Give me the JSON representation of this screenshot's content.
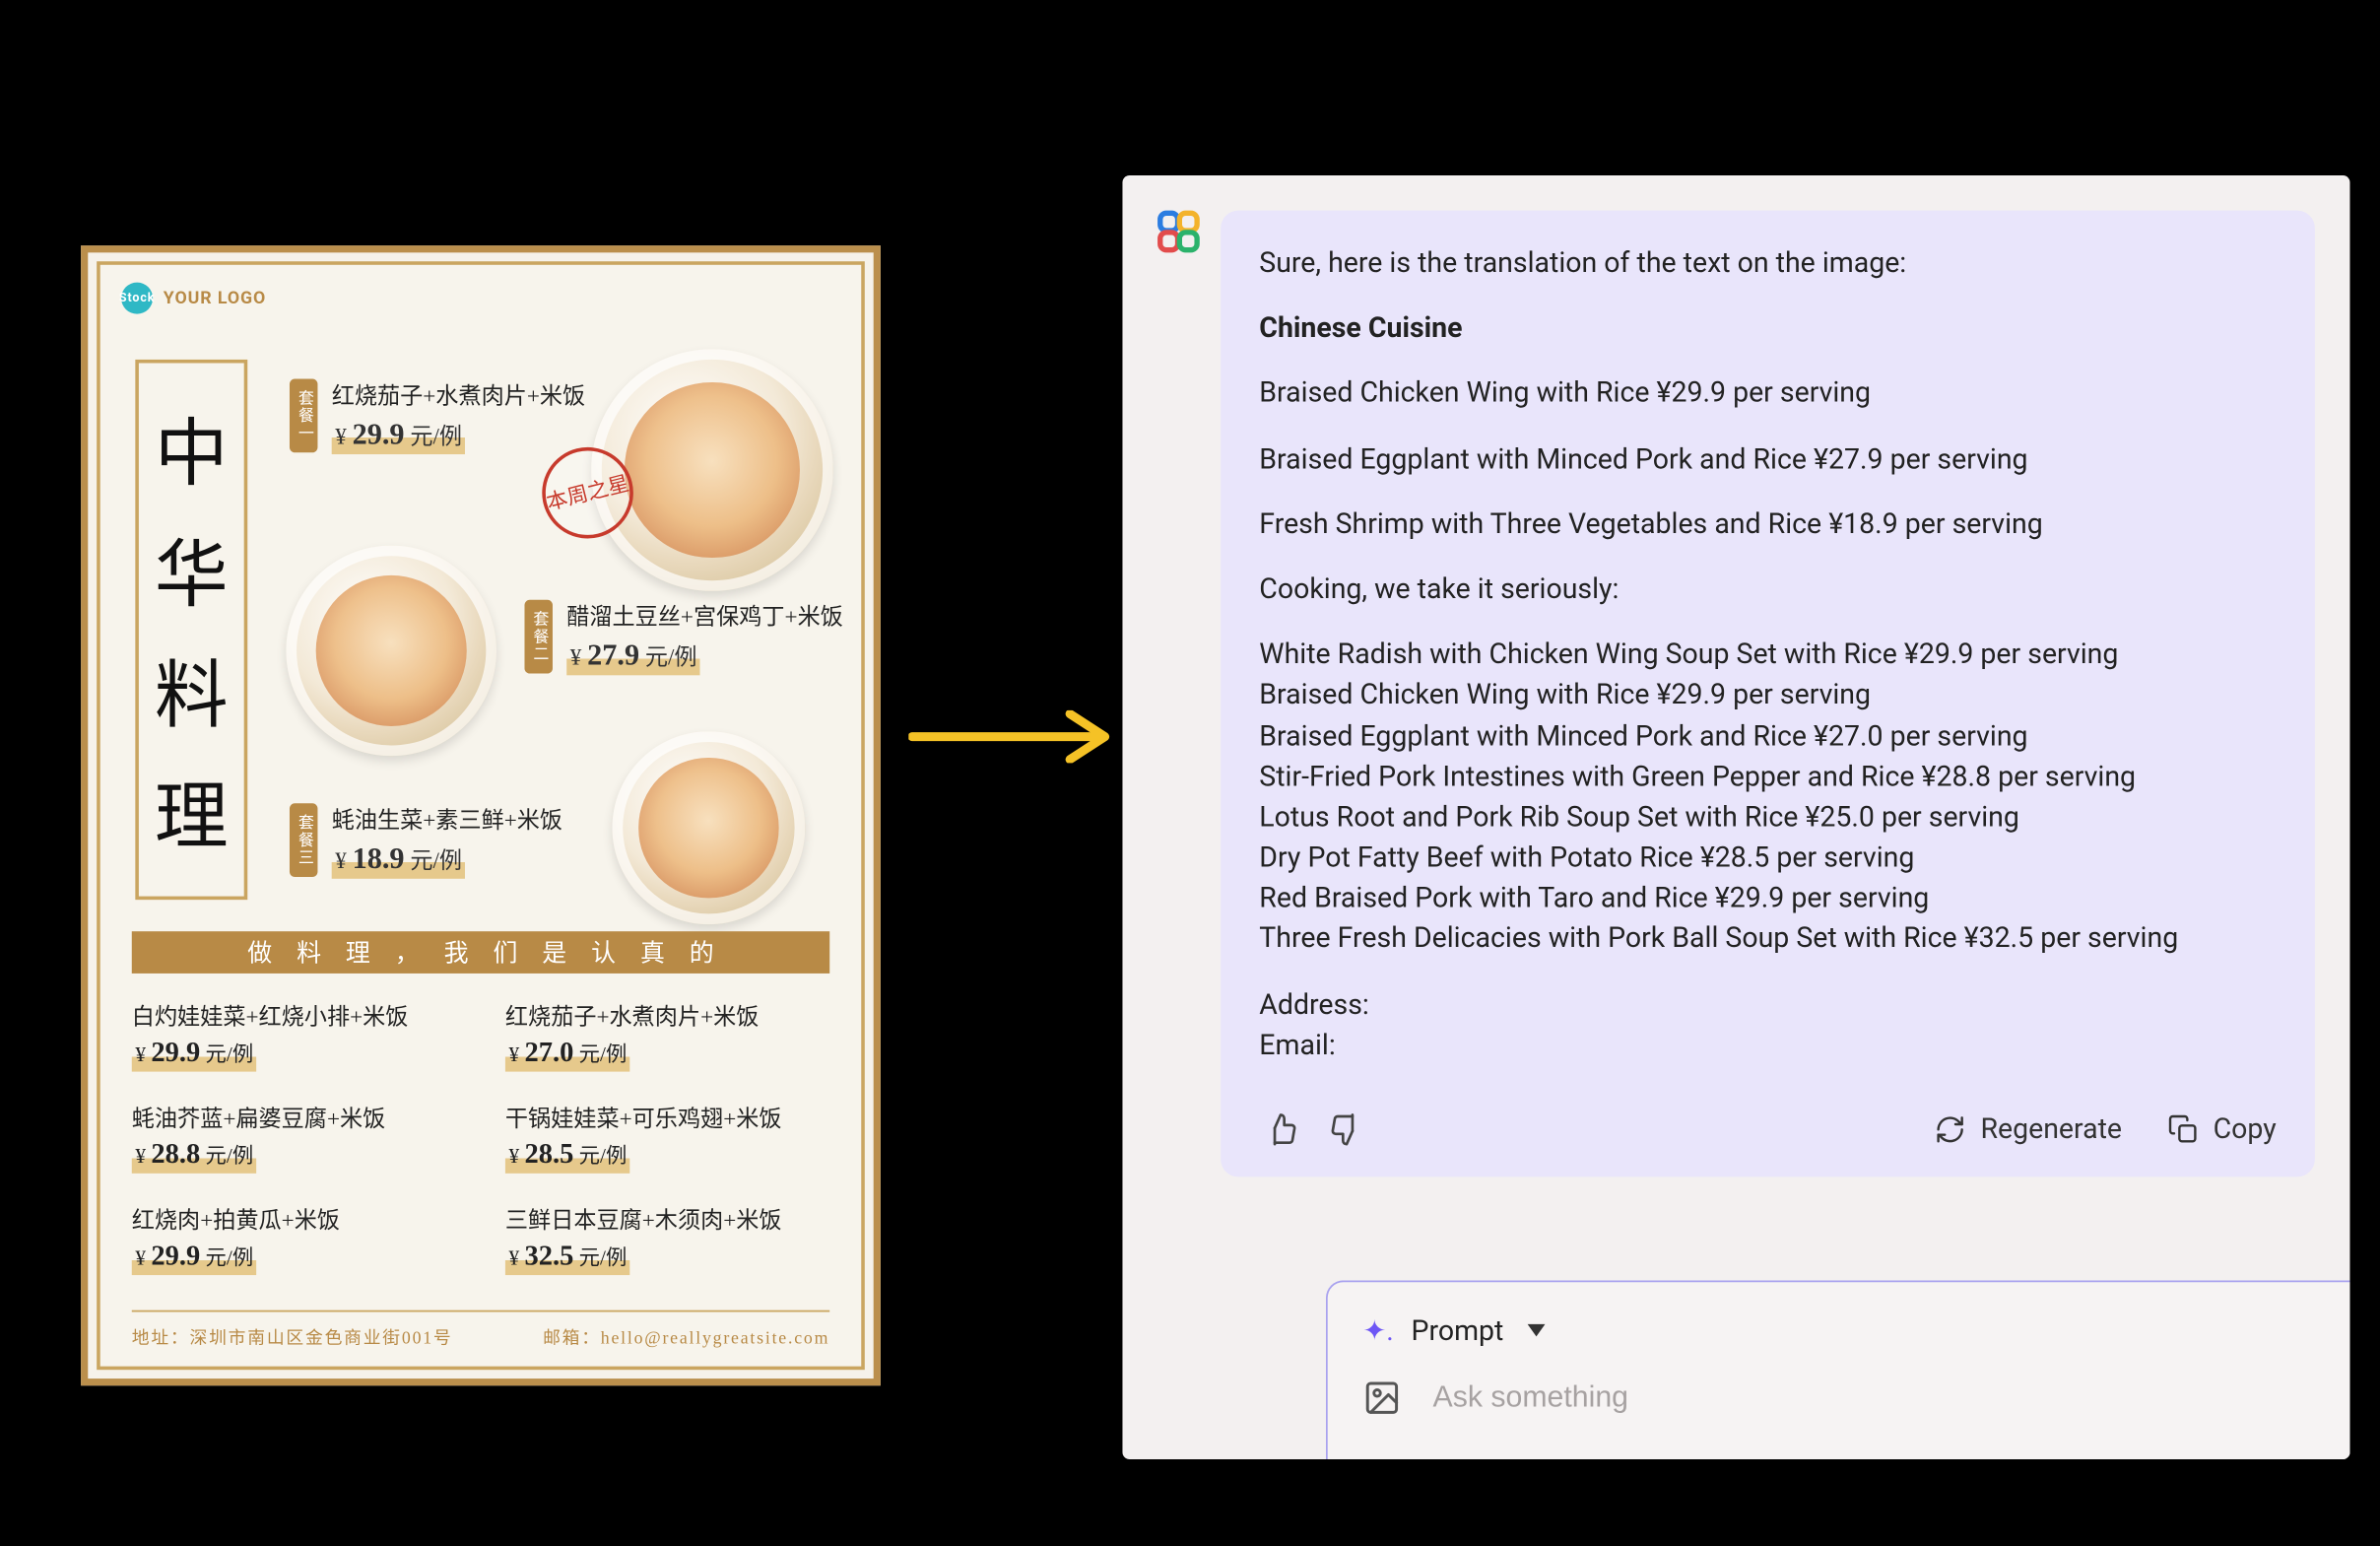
{
  "menu": {
    "logo_mark": "Stock",
    "logo_text": "YOUR LOGO",
    "title_chars": [
      "中",
      "华",
      "料",
      "理"
    ],
    "featured_badge_labels": [
      "套餐一",
      "套餐二",
      "套餐三"
    ],
    "star_stamp": "本周之星",
    "featured": [
      {
        "name": "红烧茄子+水煮肉片+米饭",
        "price_num": "29.9",
        "price_unit": "元/例"
      },
      {
        "name": "醋溜土豆丝+宫保鸡丁+米饭",
        "price_num": "27.9",
        "price_unit": "元/例"
      },
      {
        "name": "蚝油生菜+素三鲜+米饭",
        "price_num": "18.9",
        "price_unit": "元/例"
      }
    ],
    "divider": "做料理，我们是认真的",
    "combos": [
      {
        "name": "白灼娃娃菜+红烧小排+米饭",
        "price_num": "29.9",
        "price_unit": "元/例"
      },
      {
        "name": "红烧茄子+水煮肉片+米饭",
        "price_num": "27.0",
        "price_unit": "元/例"
      },
      {
        "name": "蚝油芥蓝+扁婆豆腐+米饭",
        "price_num": "28.8",
        "price_unit": "元/例"
      },
      {
        "name": "干锅娃娃菜+可乐鸡翅+米饭",
        "price_num": "28.5",
        "price_unit": "元/例"
      },
      {
        "name": "红烧肉+拍黄瓜+米饭",
        "price_num": "29.9",
        "price_unit": "元/例"
      },
      {
        "name": "三鲜日本豆腐+木须肉+米饭",
        "price_num": "32.5",
        "price_unit": "元/例"
      }
    ],
    "footer": {
      "address_label": "地址：",
      "address_value": "深圳市南山区金色商业街001号",
      "email_label": "邮箱：",
      "email_value": "hello@reallygreatsite.com"
    }
  },
  "chat": {
    "intro": "Sure, here is the translation of the text on the image:",
    "heading": "Chinese Cuisine",
    "items_top": [
      "Braised Chicken Wing with Rice ¥29.9 per serving",
      "Braised Eggplant with Minced Pork and Rice ¥27.9 per serving",
      "Fresh Shrimp with Three Vegetables and Rice ¥18.9 per serving"
    ],
    "subhead": "Cooking, we take it seriously:",
    "items_bottom": [
      "White Radish with Chicken Wing Soup Set with Rice ¥29.9 per serving",
      "Braised Chicken Wing with Rice ¥29.9 per serving",
      "Braised Eggplant with Minced Pork and Rice ¥27.0 per serving",
      "Stir-Fried Pork Intestines with Green Pepper and Rice ¥28.8 per serving",
      "Lotus Root and Pork Rib Soup Set with Rice ¥25.0 per serving",
      "Dry Pot Fatty Beef with Potato Rice ¥28.5 per serving",
      "Red Braised Pork with Taro and Rice ¥29.9 per serving",
      "Three Fresh Delicacies with Pork Ball Soup Set with Rice ¥32.5 per serving"
    ],
    "trailer": [
      "Address:",
      "Email:"
    ],
    "regenerate_label": "Regenerate",
    "copy_label": "Copy",
    "prompt_label": "Prompt",
    "placeholder": "Ask something"
  }
}
